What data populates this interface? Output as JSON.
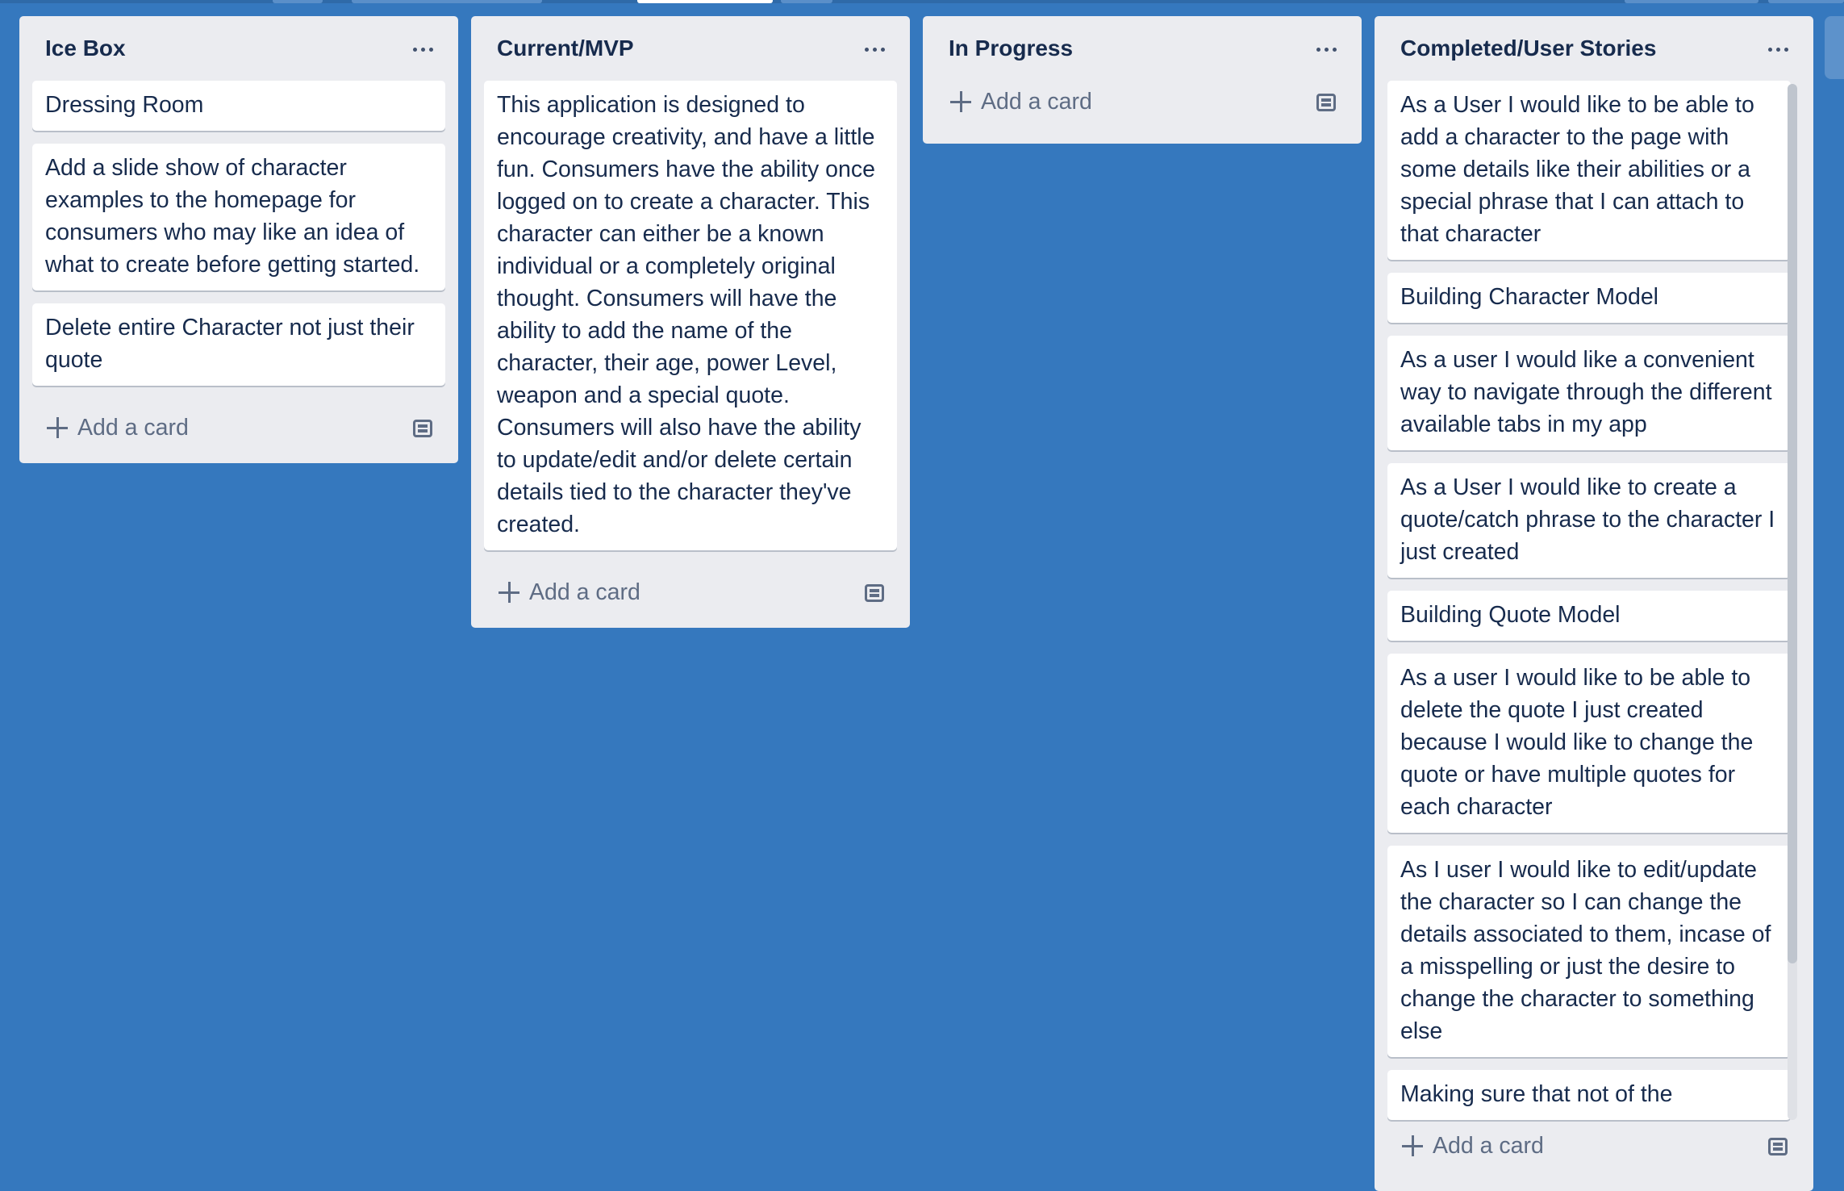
{
  "board": {
    "lists": [
      {
        "title": "Ice Box",
        "cards": [
          "Dressing Room",
          "Add a slide show of character examples to the homepage for consumers who may like an idea of what to create before getting started.",
          "Delete entire Character not just their quote"
        ],
        "add_card_label": "Add a card"
      },
      {
        "title": "Current/MVP",
        "cards": [
          "This application is designed to encourage creativity, and have a little fun. Consumers have the ability once logged on to create a character. This character can either be a known individual or a completely original thought. Consumers will have the ability to add the name of the character, their age, power Level, weapon and a special quote. Consumers will also have the ability to update/edit and/or delete certain details tied to the character they've created."
        ],
        "add_card_label": "Add a card"
      },
      {
        "title": "In Progress",
        "cards": [],
        "add_card_label": "Add a card"
      },
      {
        "title": "Completed/User Stories",
        "cards": [
          "As a User I would like to be able to add a character to the page with some details like their abilities or a special phrase that I can attach to that character",
          "Building Character Model",
          "As a user I would like a convenient way to navigate through the different available tabs in my app",
          "As a User I would like to create a quote/catch phrase to the character I just created",
          "Building Quote Model",
          "As a user I would like to be able to delete the quote I just created because I would like to change the quote or have multiple quotes for each character",
          "As I user I would like to edit/update the character so I can change the details associated to them, incase of a misspelling or just the desire to change the character to something else",
          "Making sure that not of the"
        ],
        "add_card_label": "Add a card"
      }
    ]
  },
  "icons": {
    "menu": "more-horizontal-icon",
    "add": "plus-icon",
    "template": "card-template-icon"
  },
  "colors": {
    "board_background": "#3578be",
    "list_background": "#ebecf0",
    "card_background": "#ffffff",
    "text": "#172b4d",
    "muted_text": "#5e6c84"
  }
}
